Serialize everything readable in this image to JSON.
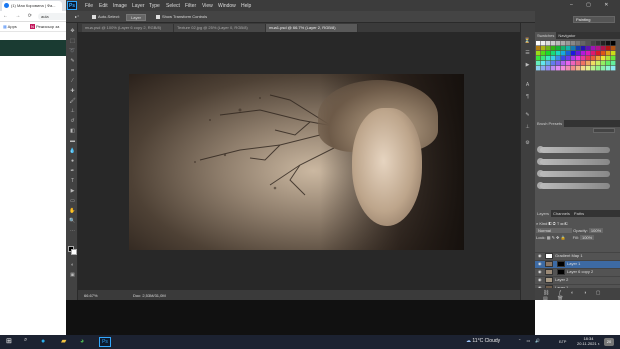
{
  "browser": {
    "tab_title": "(1) Мая Коровина | Фа...",
    "url": "aula",
    "bookmarks": [
      "Apps",
      "Режисьор за"
    ],
    "nav_glyphs": "← → ⟳"
  },
  "photoshop": {
    "logo": "Ps",
    "menu": [
      "File",
      "Edit",
      "Image",
      "Layer",
      "Type",
      "Select",
      "Filter",
      "View",
      "Window",
      "Help"
    ],
    "options": {
      "auto_select_label": "Auto-Select:",
      "auto_select_value": "Layer",
      "transform_label": "Show Transform Controls"
    },
    "doc_tabs": [
      "mua.psd @ 100% (Layer 6 copy 2, RGB/8)",
      "Texture 02.jpg @ 25% (Layer 0, RGB/8)",
      "mua1.psd @ 66.7% (Layer 2, RGB/8)"
    ],
    "active_doc_tab": 2,
    "status": {
      "zoom": "66.67%",
      "doc_size": "Doc: 2,53M/31,0M"
    },
    "workspace": "Painting",
    "window_controls": "– ▢ ✕"
  },
  "panels": {
    "swatches_tabs": [
      "Swatches",
      "Navigator"
    ],
    "brush_presets_title": "Brush Presets",
    "layers_tabs": [
      "Layers",
      "Channels",
      "Paths"
    ],
    "kind_label": "Kind",
    "blend_mode": "Normal",
    "opacity_label": "Opacity:",
    "opacity_value": "100%",
    "lock_label": "Lock:",
    "fill_label": "Fill:",
    "fill_value": "100%",
    "layers": [
      {
        "name": "Gradient Map 1",
        "selected": false
      },
      {
        "name": "Layer 1",
        "selected": true
      },
      {
        "name": "Layer 6 copy 2",
        "selected": false
      },
      {
        "name": "Layer 2",
        "selected": false
      },
      {
        "name": "Layer 1",
        "selected": false
      }
    ]
  },
  "taskbar": {
    "weather": "11°C  Cloudy",
    "language": "БГР",
    "time": "18:34",
    "date": "20.11.2021 г.",
    "badge": "20"
  },
  "colors": {
    "ps_blue": "#31a8ff",
    "selected_layer": "#3d6aa3",
    "taskbar": "#1c2231"
  }
}
